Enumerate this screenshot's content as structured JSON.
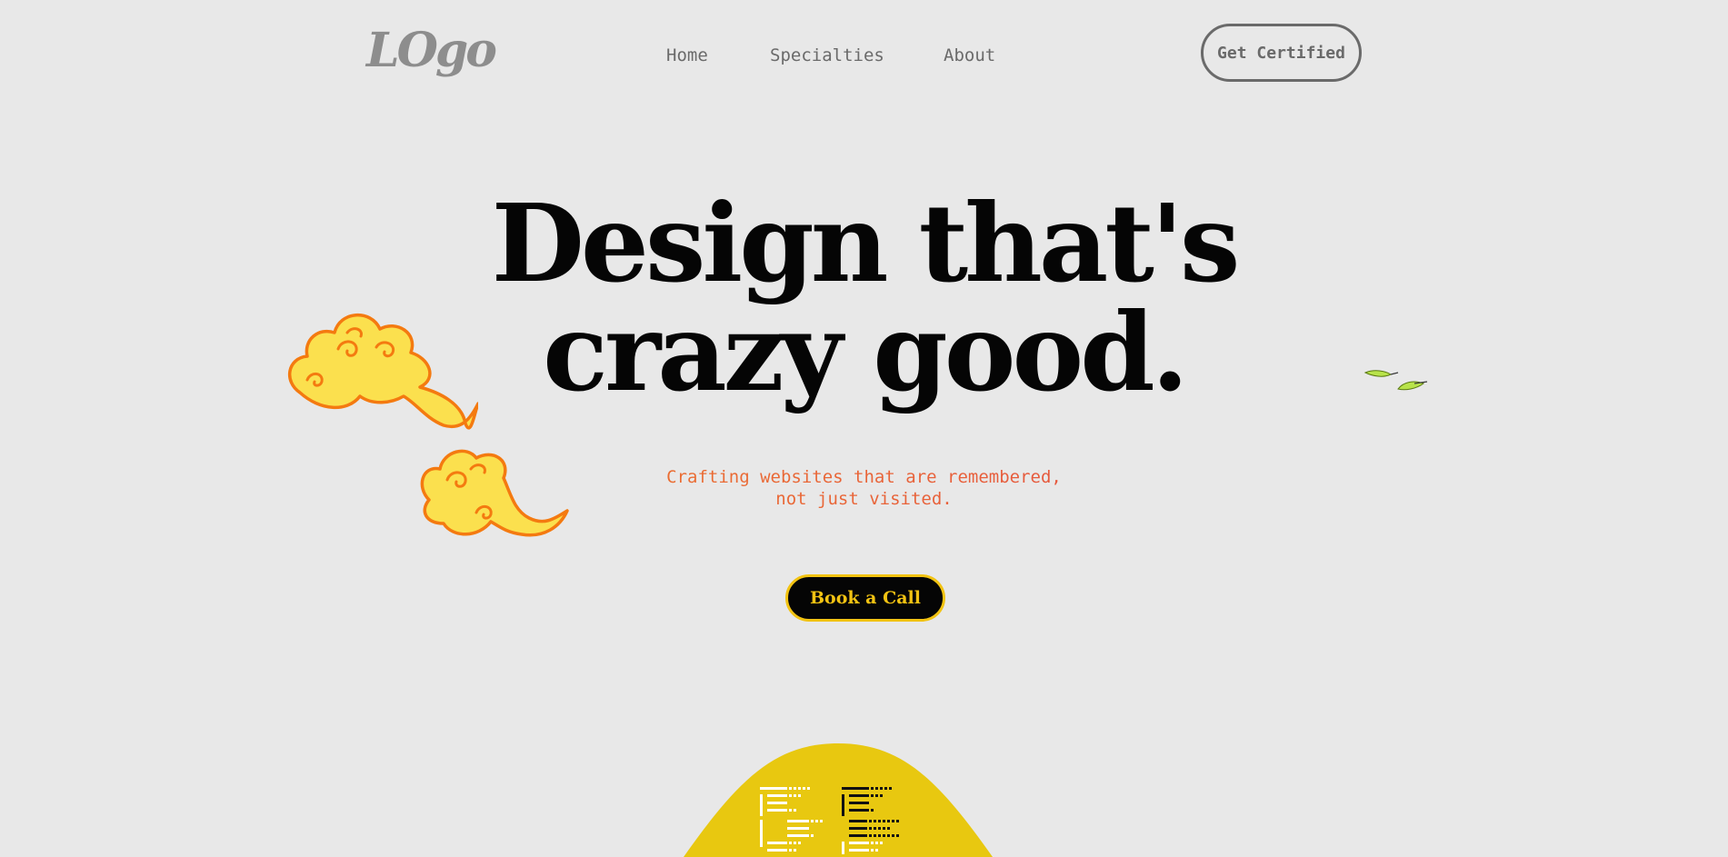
{
  "header": {
    "logo_text": "LOgo",
    "nav": {
      "home": "Home",
      "specialties": "Specialties",
      "about": "About"
    },
    "cta_label": "Get Certified"
  },
  "hero": {
    "title_line1": "Design that's",
    "title_line2": "crazy good.",
    "tagline_line1": "Crafting websites that are remembered,",
    "tagline_line2": "not just visited.",
    "button_label": "Book a Call"
  },
  "colors": {
    "background": "#e8e8e8",
    "nav_text": "#6a6a6a",
    "title": "#050505",
    "accent_yellow": "#f2c312",
    "cloud_fill": "#fbe04e",
    "cloud_stroke": "#f47a10",
    "tagline_start": "#f08a1c",
    "tagline_end": "#d8284a",
    "dome": "#e8c810"
  },
  "icons": {
    "cloud": "swirl-cloud-icon",
    "leaves": "leaf-icon"
  }
}
